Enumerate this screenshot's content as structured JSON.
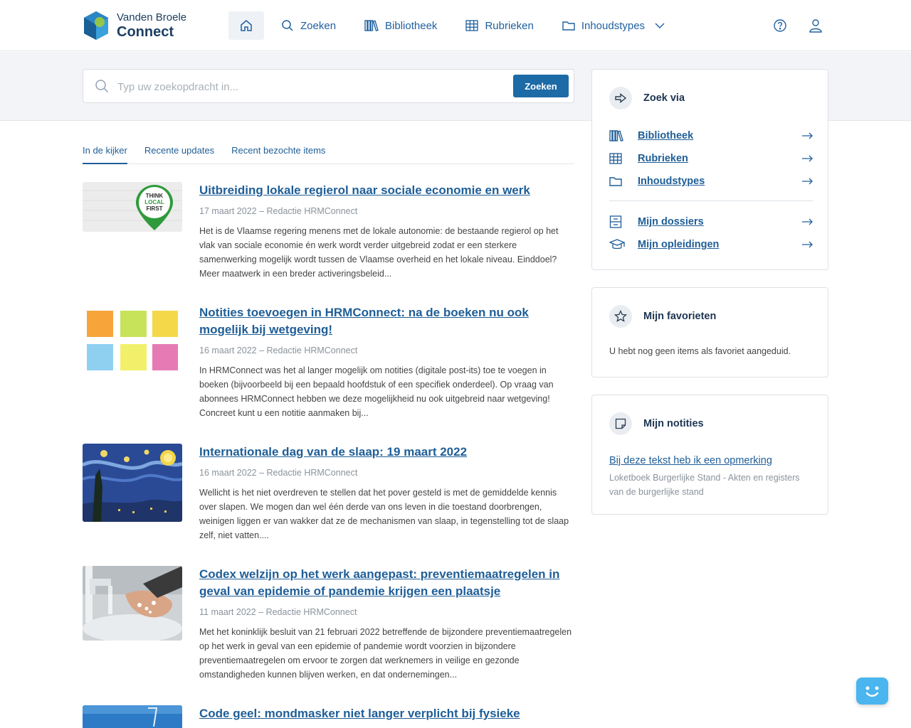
{
  "brand": {
    "line1": "Vanden Broele",
    "line2": "Connect"
  },
  "nav": {
    "home_icon": "home-icon",
    "items": [
      {
        "label": "Zoeken",
        "icon": "search-icon"
      },
      {
        "label": "Bibliotheek",
        "icon": "books-icon"
      },
      {
        "label": "Rubrieken",
        "icon": "grid-icon"
      },
      {
        "label": "Inhoudstypes",
        "icon": "folder-icon"
      }
    ],
    "right_icons": [
      "help-icon",
      "user-icon"
    ]
  },
  "search": {
    "placeholder": "Typ uw zoekopdracht in...",
    "button": "Zoeken"
  },
  "tabs": [
    {
      "label": "In de kijker",
      "active": true
    },
    {
      "label": "Recente updates",
      "active": false
    },
    {
      "label": "Recent bezochte items",
      "active": false
    }
  ],
  "articles": [
    {
      "title": "Uitbreiding lokale regierol naar sociale economie en werk",
      "meta": "17 maart 2022 – Redactie HRMConnect",
      "excerpt": "Het is de Vlaamse regering menens met de lokale autonomie: de bestaande regierol op het vlak van sociale economie én werk wordt verder uitgebreid zodat er een sterkere samenwerking mogelijk wordt tussen de Vlaamse overheid en het lokale niveau. Einddoel? Meer maatwerk in een breder activeringsbeleid...",
      "thumb_text": [
        "THINK",
        "LOCAL",
        "FIRST"
      ]
    },
    {
      "title": "Notities toevoegen in HRMConnect: na de boeken nu ook mogelijk bij wetgeving!",
      "meta": "16 maart 2022 – Redactie HRMConnect",
      "excerpt": "In HRMConnect was het al langer mogelijk om notities (digitale post-its) toe te voegen in boeken (bijvoorbeeld bij een bepaald hoofdstuk of een specifiek onderdeel). Op vraag van abonnees HRMConnect hebben we deze mogelijkheid nu ook uitgebreid naar wetgeving! Concreet kunt u een notitie aanmaken bij..."
    },
    {
      "title": "Internationale dag van de slaap: 19 maart 2022",
      "meta": "16 maart 2022 – Redactie HRMConnect",
      "excerpt": "Wellicht is het niet overdreven te stellen dat het pover gesteld is met de gemiddelde kennis over slapen. We mogen dan wel één derde van ons leven in die toestand doorbrengen, weinigen liggen er van wakker dat ze de mechanismen van slaap, in tegenstelling tot de slaap zelf, niet vatten...."
    },
    {
      "title": "Codex welzijn op het werk aangepast: preventiemaatregelen in geval van epidemie of pandemie krijgen een plaatsje",
      "meta": "11 maart 2022 – Redactie HRMConnect",
      "excerpt": "Met het koninklijk besluit van 21 februari 2022 betreffende de bijzondere preventiemaatregelen op het werk in geval van een epidemie of pandemie wordt voorzien in bijzondere preventiemaatregelen om ervoor te zorgen dat werknemers in veilige en gezonde omstandigheden kunnen blijven werken, en dat ondernemingen..."
    },
    {
      "title": "Code geel: mondmasker niet langer verplicht bij fysieke",
      "meta": "",
      "excerpt": ""
    }
  ],
  "zoek_via": {
    "title": "Zoek via",
    "links": [
      {
        "label": "Bibliotheek",
        "icon": "books-icon"
      },
      {
        "label": "Rubrieken",
        "icon": "grid-icon"
      },
      {
        "label": "Inhoudstypes",
        "icon": "folder-icon"
      },
      {
        "label": "Mijn dossiers",
        "icon": "archive-icon"
      },
      {
        "label": "Mijn opleidingen",
        "icon": "graduation-cap-icon"
      }
    ]
  },
  "favorieten": {
    "title": "Mijn favorieten",
    "empty": "U hebt nog geen items als favoriet aangeduid."
  },
  "notities": {
    "title": "Mijn notities",
    "note_title": "Bij deze tekst heb ik een opmerking",
    "note_source": "Loketboek Burgerlijke Stand - Akten en registers van de burgerlijke stand"
  },
  "colors": {
    "accent": "#1c6aa6",
    "link": "#1f5e97",
    "band": "#f3f4f7",
    "chatbot": "#4ab5ee"
  }
}
